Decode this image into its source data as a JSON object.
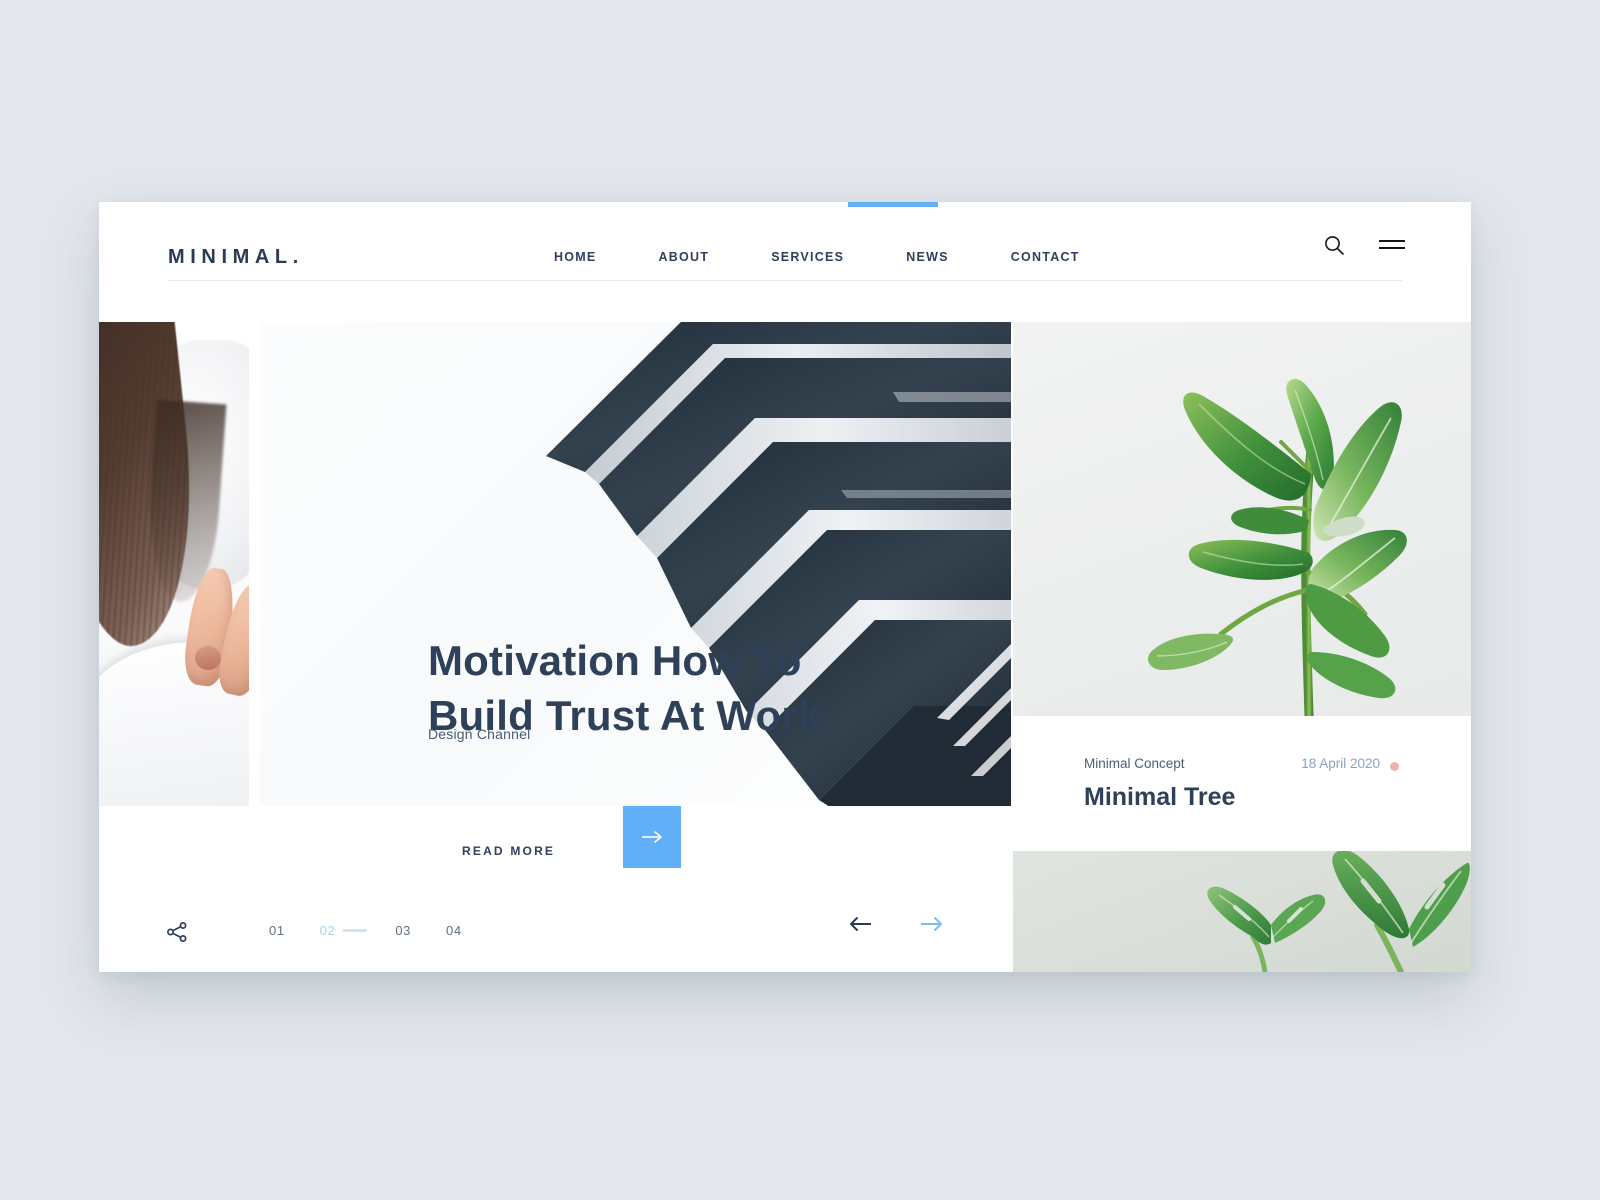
{
  "brand": {
    "logo": "MINIMAL."
  },
  "nav": {
    "items": [
      {
        "label": "HOME"
      },
      {
        "label": "ABOUT"
      },
      {
        "label": "SERVICES"
      },
      {
        "label": "NEWS"
      },
      {
        "label": "CONTACT"
      }
    ]
  },
  "header_actions": {
    "search_icon": "search-icon",
    "menu_icon": "hamburger-icon"
  },
  "hero": {
    "title": "Motivation How To Build Trust At Work",
    "title_line1": "Motivation How To",
    "title_line2": "Build Trust At Work",
    "subtitle": "Design Channel",
    "read_more_label": "READ MORE",
    "arrow_glyph": "→"
  },
  "slider": {
    "share_icon": "share-icon",
    "pages": [
      {
        "label": "01",
        "active": false
      },
      {
        "label": "02",
        "active": true
      },
      {
        "label": "03",
        "active": false
      },
      {
        "label": "04",
        "active": false
      }
    ],
    "prev_glyph": "←",
    "next_glyph": "→"
  },
  "featured_card": {
    "category": "Minimal Concept",
    "date": "18 April 2020",
    "title": "Minimal Tree"
  },
  "colors": {
    "page_background": "#e4e8ec",
    "panel": "#ffffff",
    "accent_blue": "#61b0f7",
    "text_navy": "#2e4158",
    "muted": "#5e7085",
    "date_blue": "#8aa3c4",
    "pager_active": "#a9cfe6",
    "dot_pink": "#f1b0ae"
  }
}
